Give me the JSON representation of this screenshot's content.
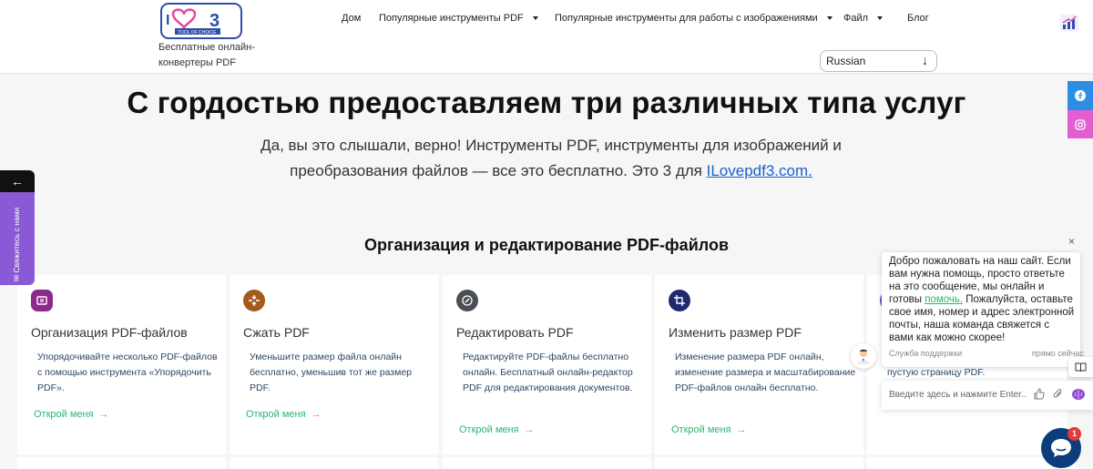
{
  "header": {
    "logo_text": "ILOVE PDF3",
    "logo_sub": "TOOL OF CHOICE",
    "tagline": "Бесплатные онлайн-конвертеры PDF",
    "nav": [
      {
        "label": "Дом",
        "has_caret": false
      },
      {
        "label": "Популярные инструменты PDF",
        "has_caret": true
      },
      {
        "label": "Популярные инструменты для работы с изображениями",
        "has_caret": true
      },
      {
        "label": "Файл",
        "has_caret": true
      },
      {
        "label": "Блог",
        "has_caret": false
      }
    ],
    "language": "Russian"
  },
  "hero": {
    "title": "С гордостью предоставляем три различных типа услуг",
    "subtitle": "Да, вы это слышали, верно! Инструменты PDF, инструменты для изображений и преобразования файлов — все это бесплатно. Это 3 для",
    "link": "ILovepdf3.com."
  },
  "section": {
    "title": "Организация и редактирование PDF-файлов"
  },
  "cards": [
    {
      "title": "Организация PDF-файлов",
      "desc": "Упорядочивайте несколько PDF-файлов с помощью инструмента «Упорядочить PDF».",
      "link": "Открой меня",
      "arrow": "→",
      "icon": "organize-icon",
      "color": "#8e2a8a"
    },
    {
      "title": "Сжать PDF",
      "desc": "Уменьшите размер файла онлайн бесплатно, уменьшив тот же размер PDF.",
      "link": "Открой меня",
      "arrow": "→",
      "icon": "compress-icon",
      "color": "#a35a1c"
    },
    {
      "title": "Редактировать PDF",
      "desc": "Редактируйте PDF-файлы бесплатно онлайн. Бесплатный онлайн-редактор PDF для редактирования документов.",
      "link": "Открой меня",
      "arrow": "→",
      "icon": "edit-icon",
      "color": "#4a4f55"
    },
    {
      "title": "Изменить размер PDF",
      "desc": "Изменение размера PDF онлайн, изменение размера и масштабирование PDF-файлов онлайн бесплатно.",
      "link": "Открой меня",
      "arrow": "→",
      "icon": "crop-icon",
      "color": "#1f2a6e"
    }
  ],
  "contact_tab": {
    "arrow": "←",
    "label": "Свяжитесь с нами"
  },
  "chat": {
    "close": "×",
    "message_before": "Добро пожаловать на наш сайт. Если вам нужна помощь, просто ответьте на это сообщение, мы онлайн и готовы",
    "message_link": "помочь.",
    "message_after": "Пожалуйста, оставьте свое имя, номер и адрес электронной почты, наша команда свяжется с вами как можно скорее!",
    "sender": "Служба поддержки",
    "time": "прямо сейчас",
    "input_placeholder": "Введите здесь и нажмите Enter..",
    "badge": "1",
    "behind_text": "пустую страницу PDF."
  }
}
